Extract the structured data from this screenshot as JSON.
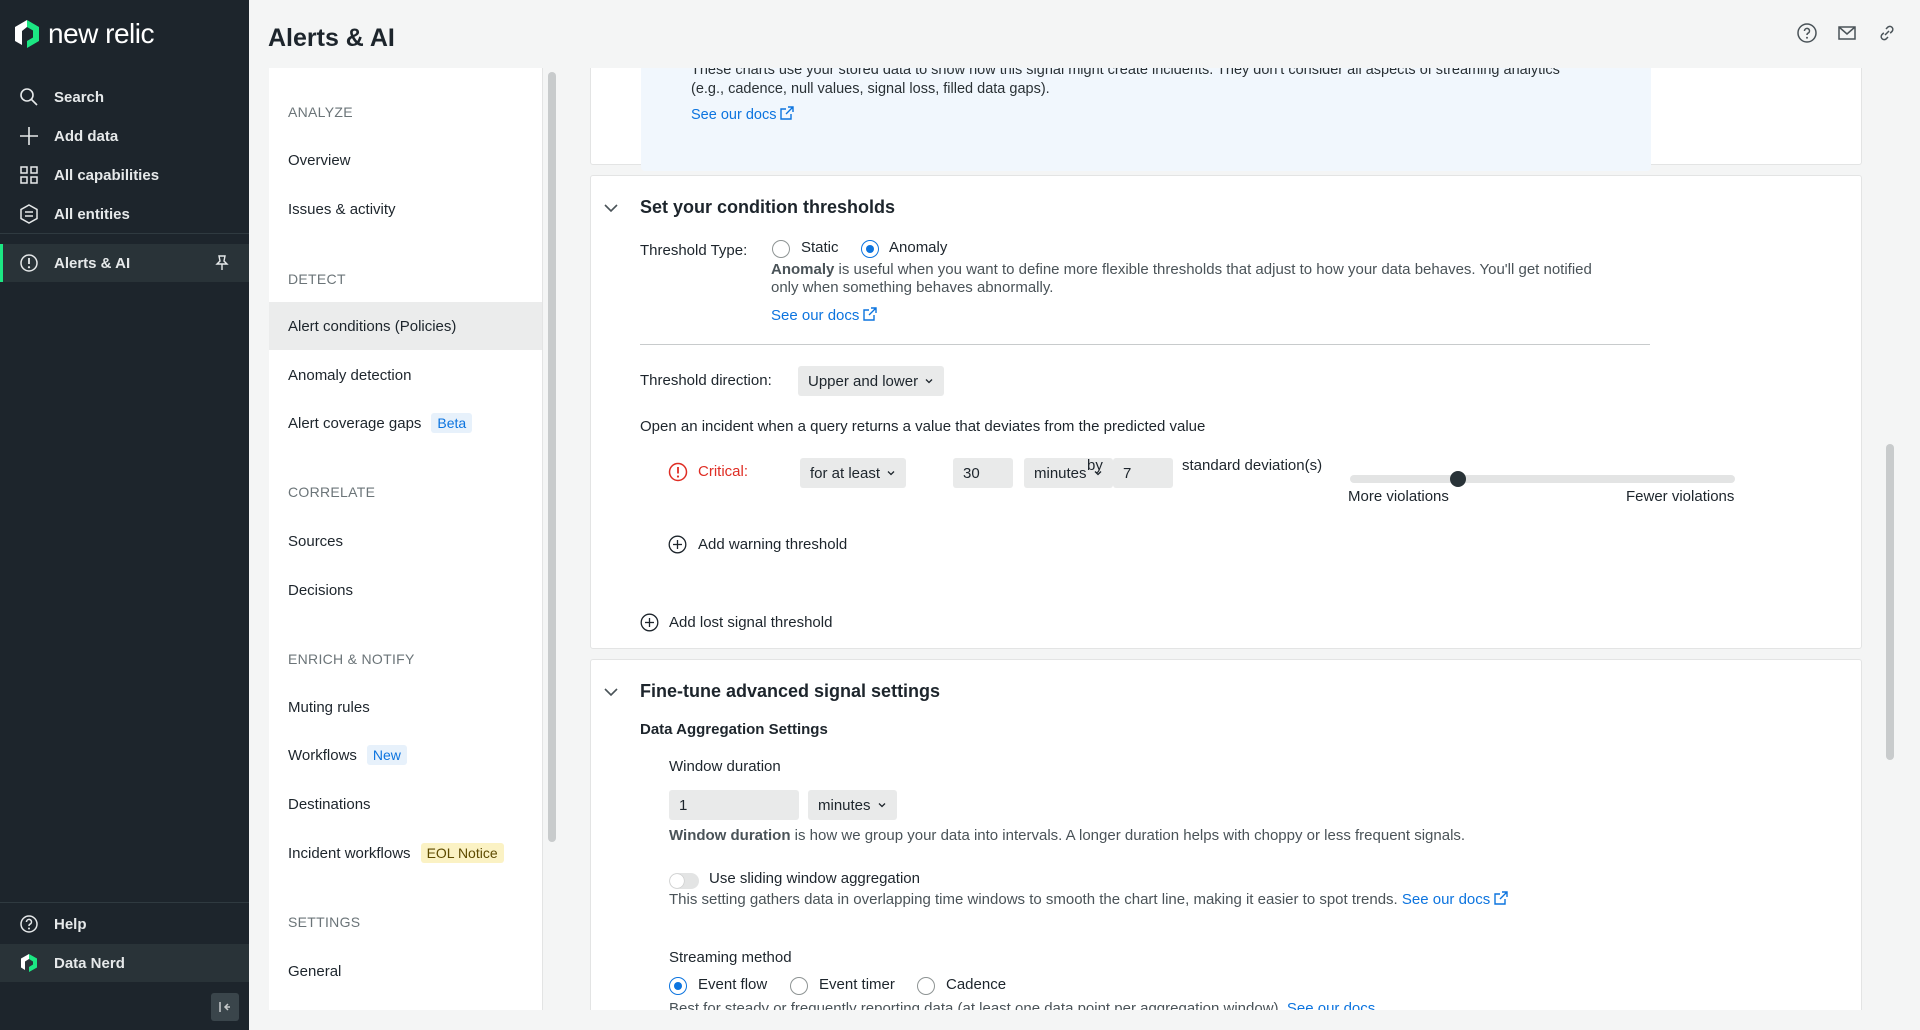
{
  "brand": {
    "name": "new relic"
  },
  "global_nav": {
    "items": [
      {
        "label": "Search",
        "icon": "search-icon"
      },
      {
        "label": "Add data",
        "icon": "plus-icon"
      },
      {
        "label": "All capabilities",
        "icon": "grid-icon"
      },
      {
        "label": "All entities",
        "icon": "entities-icon"
      },
      {
        "label": "Alerts & AI",
        "icon": "alert-icon",
        "active": true
      }
    ],
    "bottom": [
      {
        "label": "Help",
        "icon": "help-icon"
      },
      {
        "label": "Data Nerd",
        "icon": "user-logo-icon"
      }
    ]
  },
  "header": {
    "title": "Alerts & AI"
  },
  "secondary_nav": {
    "sections": [
      {
        "title": "ANALYZE",
        "items": [
          {
            "label": "Overview"
          },
          {
            "label": "Issues & activity"
          }
        ]
      },
      {
        "title": "DETECT",
        "items": [
          {
            "label": "Alert conditions (Policies)",
            "selected": true
          },
          {
            "label": "Anomaly detection"
          },
          {
            "label": "Alert coverage gaps",
            "badge": "Beta"
          }
        ]
      },
      {
        "title": "CORRELATE",
        "items": [
          {
            "label": "Sources"
          },
          {
            "label": "Decisions"
          }
        ]
      },
      {
        "title": "ENRICH & NOTIFY",
        "items": [
          {
            "label": "Muting rules"
          },
          {
            "label": "Workflows",
            "badge": "New"
          },
          {
            "label": "Destinations"
          },
          {
            "label": "Incident workflows",
            "badge": "EOL Notice"
          }
        ]
      },
      {
        "title": "SETTINGS",
        "items": [
          {
            "label": "General"
          }
        ]
      }
    ]
  },
  "info_box": {
    "line1": "These charts use your stored data to show how this signal might create incidents. They don't consider all aspects of streaming analytics",
    "line2": "(e.g., cadence, null values, signal loss, filled data gaps).",
    "link": "See our docs"
  },
  "thresholds": {
    "title": "Set your condition thresholds",
    "type_label": "Threshold Type:",
    "options": [
      "Static",
      "Anomaly"
    ],
    "selected": "Anomaly",
    "desc_bold": "Anomaly",
    "desc_rest": " is useful when you want to define more flexible thresholds that adjust to how your data behaves. You'll get notified",
    "desc_line2": "only when something behaves abnormally.",
    "docs_link": "See our docs",
    "direction_label": "Threshold direction:",
    "direction_value": "Upper and lower",
    "incident_text": "Open an incident when a query returns a value that deviates from the predicted value",
    "critical_label": "Critical:",
    "for_value": "for at least",
    "duration_value": "30",
    "unit_value": "minutes",
    "by_label": "by",
    "deviation_value": "7",
    "deviation_label": "standard deviation(s)",
    "slider_left": "More violations",
    "slider_right": "Fewer violations",
    "slider_position": 0.28,
    "add_warning": "Add warning threshold",
    "add_lost_signal": "Add lost signal threshold"
  },
  "advanced": {
    "title": "Fine-tune advanced signal settings",
    "subtitle": "Data Aggregation Settings",
    "window_label": "Window duration",
    "window_value": "1",
    "window_unit": "minutes",
    "window_desc_bold": "Window duration",
    "window_desc_rest": " is how we group your data into intervals. A longer duration helps with choppy or less frequent signals.",
    "sliding_label": "Use sliding window aggregation",
    "sliding_desc": "This setting gathers data in overlapping time windows to smooth the chart line, making it easier to spot trends.",
    "sliding_link": "See our docs",
    "streaming_label": "Streaming method",
    "streaming_options": [
      "Event flow",
      "Event timer",
      "Cadence"
    ],
    "streaming_selected": "Event flow",
    "streaming_desc": "Best for steady or frequently reporting data (at least one data point per aggregation window).",
    "streaming_link": "See our docs"
  },
  "colors": {
    "accent": "#0c74df",
    "critical": "#df2d24",
    "brand_green": "#1ce783",
    "nav_bg": "#1d252c"
  }
}
